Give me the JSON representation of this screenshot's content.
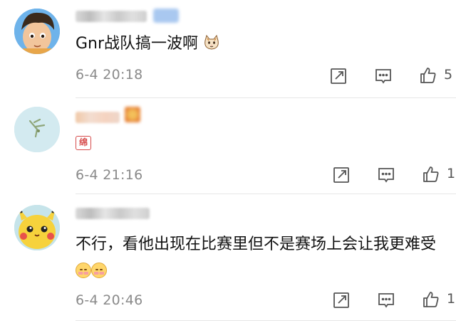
{
  "comments": [
    {
      "text": "Gnr战队搞一波啊",
      "time": "6-4 20:18",
      "likes": "5",
      "emoji": "cat-face"
    },
    {
      "text": "",
      "time": "6-4 21:16",
      "likes": "1",
      "badge": "绵"
    },
    {
      "text": "不行，看他出现在比赛里但不是赛场上会让我更难受",
      "time": "6-4 20:46",
      "likes": "1",
      "emoji": "blush-face"
    }
  ],
  "icons": {
    "share": "share-icon",
    "comment": "comment-icon",
    "like": "thumbs-up-icon"
  },
  "colors": {
    "text": "#111111",
    "meta": "#8a8a8a",
    "icon": "#555555",
    "divider": "#e6e6e6"
  }
}
